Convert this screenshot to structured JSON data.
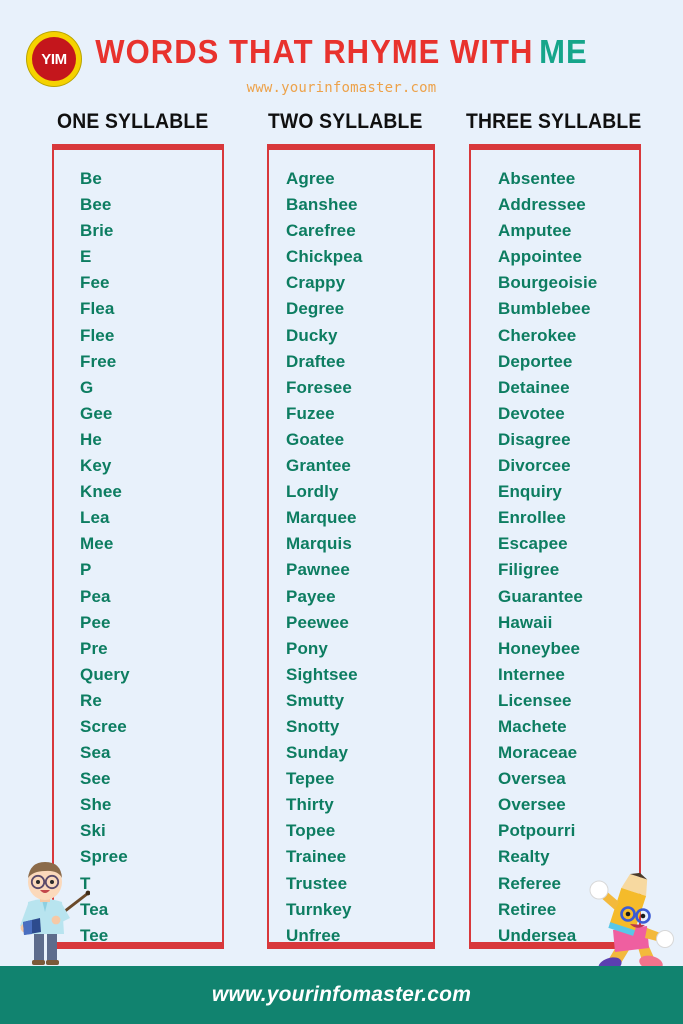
{
  "header": {
    "logo_text": "YIM",
    "title_main": "WORDS THAT RHYME WITH",
    "title_accent": "ME",
    "subtitle": "www.yourinfomaster.com"
  },
  "columns": [
    {
      "heading": "ONE SYLLABLE",
      "words": [
        "Be",
        "Bee",
        "Brie",
        "E",
        "Fee",
        "Flea",
        "Flee",
        "Free",
        "G",
        "Gee",
        "He",
        "Key",
        "Knee",
        "Lea",
        "Mee",
        "P",
        "Pea",
        "Pee",
        "Pre",
        "Query",
        "Re",
        "Scree",
        "Sea",
        "See",
        "She",
        "Ski",
        "Spree",
        "T",
        "Tea",
        "Tee"
      ]
    },
    {
      "heading": "TWO SYLLABLE",
      "words": [
        "Agree",
        "Banshee",
        "Carefree",
        "Chickpea",
        "Crappy",
        "Degree",
        "Ducky",
        "Draftee",
        "Foresee",
        "Fuzee",
        "Goatee",
        "Grantee",
        "Lordly",
        "Marquee",
        "Marquis",
        "Pawnee",
        "Payee",
        "Peewee",
        "Pony",
        "Sightsee",
        "Smutty",
        "Snotty",
        "Sunday",
        "Tepee",
        "Thirty",
        "Topee",
        "Trainee",
        "Trustee",
        "Turnkey",
        "Unfree"
      ]
    },
    {
      "heading": "THREE SYLLABLE",
      "words": [
        "Absentee",
        "Addressee",
        "Amputee",
        "Appointee",
        "Bourgeoisie",
        "Bumblebee",
        "Cherokee",
        "Deportee",
        "Detainee",
        "Devotee",
        "Disagree",
        "Divorcee",
        "Enquiry",
        "Enrollee",
        "Escapee",
        "Filigree",
        "Guarantee",
        "Hawaii",
        "Honeybee",
        "Internee",
        "Licensee",
        "Machete",
        "Moraceae",
        "Oversea",
        "Oversee",
        "Potpourri",
        "Realty",
        "Referee",
        "Retiree",
        "Undersea"
      ]
    }
  ],
  "footer": {
    "url": "www.yourinfomaster.com"
  },
  "colors": {
    "background": "#e8f1fb",
    "title_red": "#e8322d",
    "title_teal": "#15a58a",
    "word_green": "#0d7d61",
    "box_border_red": "#d8383b",
    "subtitle_orange": "#eda24a",
    "footer_teal": "#11836f",
    "logo_red": "#c4161c",
    "logo_yellow": "#f5d200"
  }
}
